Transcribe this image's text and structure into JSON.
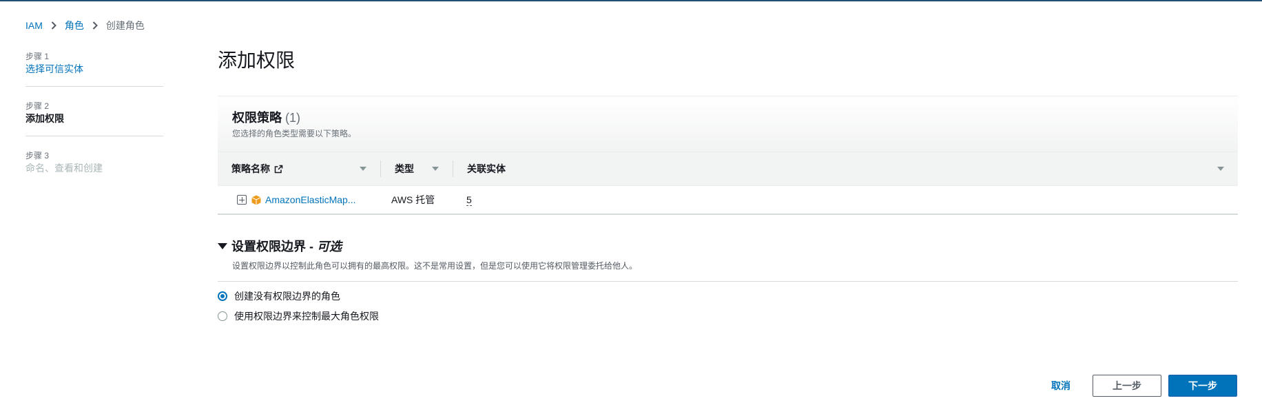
{
  "breadcrumb": {
    "items": [
      "IAM",
      "角色",
      "创建角色"
    ]
  },
  "steps": [
    {
      "num": "步骤 1",
      "label": "选择可信实体"
    },
    {
      "num": "步骤 2",
      "label": "添加权限"
    },
    {
      "num": "步骤 3",
      "label": "命名、查看和创建"
    }
  ],
  "page": {
    "title": "添加权限"
  },
  "policies": {
    "title": "权限策略",
    "count": "(1)",
    "description": "您选择的角色类型需要以下策略。",
    "columns": [
      "策略名称",
      "类型",
      "关联实体"
    ],
    "rows": [
      {
        "name": "AmazonElasticMap...",
        "type": "AWS 托管",
        "entities": "5"
      }
    ]
  },
  "boundary": {
    "title": "设置权限边界 -",
    "optional": "可选",
    "description": "设置权限边界以控制此角色可以拥有的最高权限。这不是常用设置，但是您可以使用它将权限管理委托给他人。",
    "options": [
      {
        "label": "创建没有权限边界的角色",
        "selected": true
      },
      {
        "label": "使用权限边界来控制最大角色权限",
        "selected": false
      }
    ]
  },
  "footer": {
    "cancel": "取消",
    "previous": "上一步",
    "next": "下一步"
  },
  "colors": {
    "link": "#0073bb",
    "primary": "#0073bb",
    "policy_icon": "#ec9c1f"
  }
}
